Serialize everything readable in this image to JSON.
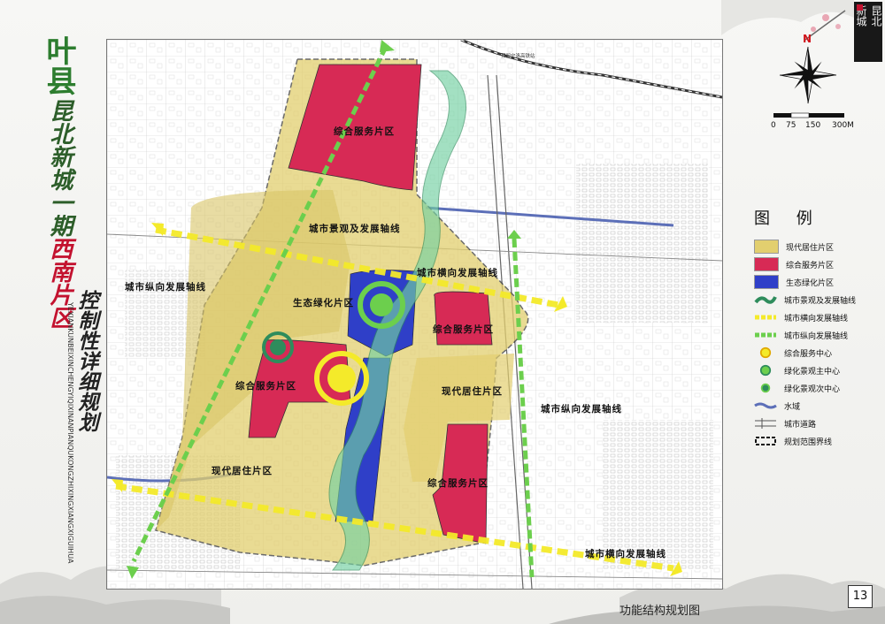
{
  "title": {
    "county": "叶县",
    "project": "昆北新城一期",
    "zone": "西南片区",
    "subtitle": "控制性详细规划",
    "pinyin": "YEXIANKUNBEIXINCHENGYIQIXINANPIANQUKONGZHIXINGXIANGXIGUIHUA"
  },
  "seal": {
    "line1": "昆北",
    "line2": "新城"
  },
  "compass": {
    "north_label": "N"
  },
  "scale_bar": {
    "ticks": [
      "0",
      "75",
      "150",
      "300M"
    ]
  },
  "legend": {
    "title": "图 例",
    "items": [
      {
        "label": "现代居住片区",
        "symbol": "yellow-fill"
      },
      {
        "label": "综合服务片区",
        "symbol": "red-fill"
      },
      {
        "label": "生态绿化片区",
        "symbol": "blue-fill"
      },
      {
        "label": "城市景观及发展轴线",
        "symbol": "green-arrow-axis"
      },
      {
        "label": "城市横向发展轴线",
        "symbol": "yellow-dashed-axis"
      },
      {
        "label": "城市纵向发展轴线",
        "symbol": "green-dashed-axis"
      },
      {
        "label": "综合服务中心",
        "symbol": "yellow-circle"
      },
      {
        "label": "绿化景观主中心",
        "symbol": "green-circle-large"
      },
      {
        "label": "绿化景观次中心",
        "symbol": "green-circle-small"
      },
      {
        "label": "水域",
        "symbol": "water-line"
      },
      {
        "label": "城市道路",
        "symbol": "road-lines"
      },
      {
        "label": "规划范围界线",
        "symbol": "boundary-dashed"
      }
    ]
  },
  "colors": {
    "residential": "#e2cf6f",
    "service": "#d72a55",
    "ecology": "#2f3fc8",
    "axis_green": "#6ccf4d",
    "axis_yellow": "#f4ea2a",
    "landscape": "#73d1a2"
  },
  "map_labels": {
    "service_north": "综合服务片区",
    "landscape_axis": "城市景观及发展轴线",
    "horizontal_axis_north": "城市横向发展轴线",
    "vertical_axis_west": "城市纵向发展轴线",
    "ecology_zone": "生态绿化片区",
    "service_east": "综合服务片区",
    "service_west": "综合服务片区",
    "residential_east": "现代居住片区",
    "vertical_axis_east": "城市纵向发展轴线",
    "residential_southwest": "现代居住片区",
    "service_south": "综合服务片区",
    "horizontal_axis_south": "城市横向发展轴线",
    "railway_note": "预留宁洛高铁站"
  },
  "caption": "功能结构规划图",
  "page_number": "13"
}
